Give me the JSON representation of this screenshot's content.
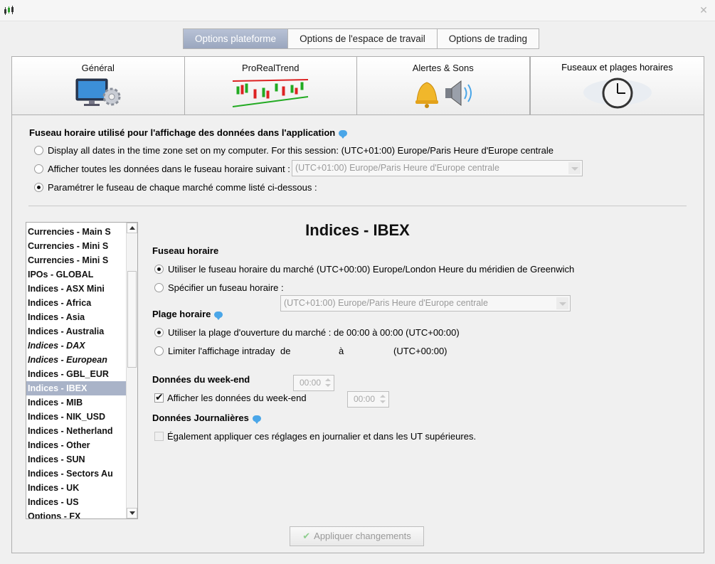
{
  "window": {
    "close_glyph": "✕"
  },
  "top_tabs": [
    {
      "label": "Options plateforme",
      "active": true
    },
    {
      "label": "Options de l'espace de travail",
      "active": false
    },
    {
      "label": "Options de trading",
      "active": false
    }
  ],
  "icon_tabs": [
    {
      "label": "Général",
      "icon": "monitor-gear-icon"
    },
    {
      "label": "ProRealTrend",
      "icon": "candlestick-trend-icon"
    },
    {
      "label": "Alertes & Sons",
      "icon": "bell-speaker-icon"
    },
    {
      "label": "Fuseaux et plages horaires",
      "icon": "clock-world-icon",
      "active": true
    }
  ],
  "timezone_section": {
    "heading": "Fuseau horaire utilisé pour l'affichage des données dans l'application",
    "option_computer": "Display all dates in the time zone set on my computer. For this session: (UTC+01:00) Europe/Paris Heure d'Europe centrale",
    "option_fixed": "Afficher toutes les données dans le fuseau horaire suivant :",
    "option_fixed_value": "(UTC+01:00) Europe/Paris Heure d'Europe centrale",
    "option_per_market": "Paramétrer le fuseau de chaque marché comme listé ci-dessous :",
    "selected": "per_market"
  },
  "market_list": [
    {
      "label": "Currencies - Main S"
    },
    {
      "label": "Currencies - Mini S"
    },
    {
      "label": "Currencies - Mini S"
    },
    {
      "label": "IPOs - GLOBAL"
    },
    {
      "label": "Indices - ASX Mini"
    },
    {
      "label": "Indices - Africa"
    },
    {
      "label": "Indices - Asia"
    },
    {
      "label": "Indices - Australia"
    },
    {
      "label": "Indices - DAX",
      "italic": true
    },
    {
      "label": "Indices - European",
      "italic": true
    },
    {
      "label": "Indices - GBL_EUR"
    },
    {
      "label": "Indices - IBEX",
      "selected": true
    },
    {
      "label": "Indices - MIB"
    },
    {
      "label": "Indices - NIK_USD"
    },
    {
      "label": "Indices - Netherland"
    },
    {
      "label": "Indices - Other"
    },
    {
      "label": "Indices - SUN"
    },
    {
      "label": "Indices - Sectors Au"
    },
    {
      "label": "Indices - UK"
    },
    {
      "label": "Indices - US"
    },
    {
      "label": "Options - FX"
    }
  ],
  "market_detail": {
    "title": "Indices - IBEX",
    "fuseau_heading": "Fuseau horaire",
    "fuseau_market": "Utiliser le fuseau horaire du marché (UTC+00:00) Europe/London Heure du méridien de Greenwich",
    "fuseau_specify": "Spécifier un fuseau horaire :",
    "fuseau_specify_value": "(UTC+01:00) Europe/Paris Heure d'Europe centrale",
    "plage_heading": "Plage horaire",
    "plage_market": "Utiliser la plage d'ouverture du marché : de 00:00 à 00:00  (UTC+00:00)",
    "plage_limit": "Limiter l'affichage intraday",
    "plage_de": "de",
    "plage_from": "00:00",
    "plage_a": "à",
    "plage_to": "00:00",
    "plage_tz": "(UTC+00:00)",
    "weekend_heading": "Données du week-end",
    "weekend_checkbox": "Afficher les données du week-end",
    "weekend_checked": true,
    "daily_heading": "Données Journalières",
    "daily_checkbox": "Également appliquer ces réglages en journalier et dans les UT supérieures.",
    "daily_checked": false
  },
  "apply_button": "Appliquer changements",
  "colors": {
    "accent_tab": "#9aa6be",
    "selected_row": "#a9b3c8",
    "help_bubble": "#4aa6e8"
  }
}
